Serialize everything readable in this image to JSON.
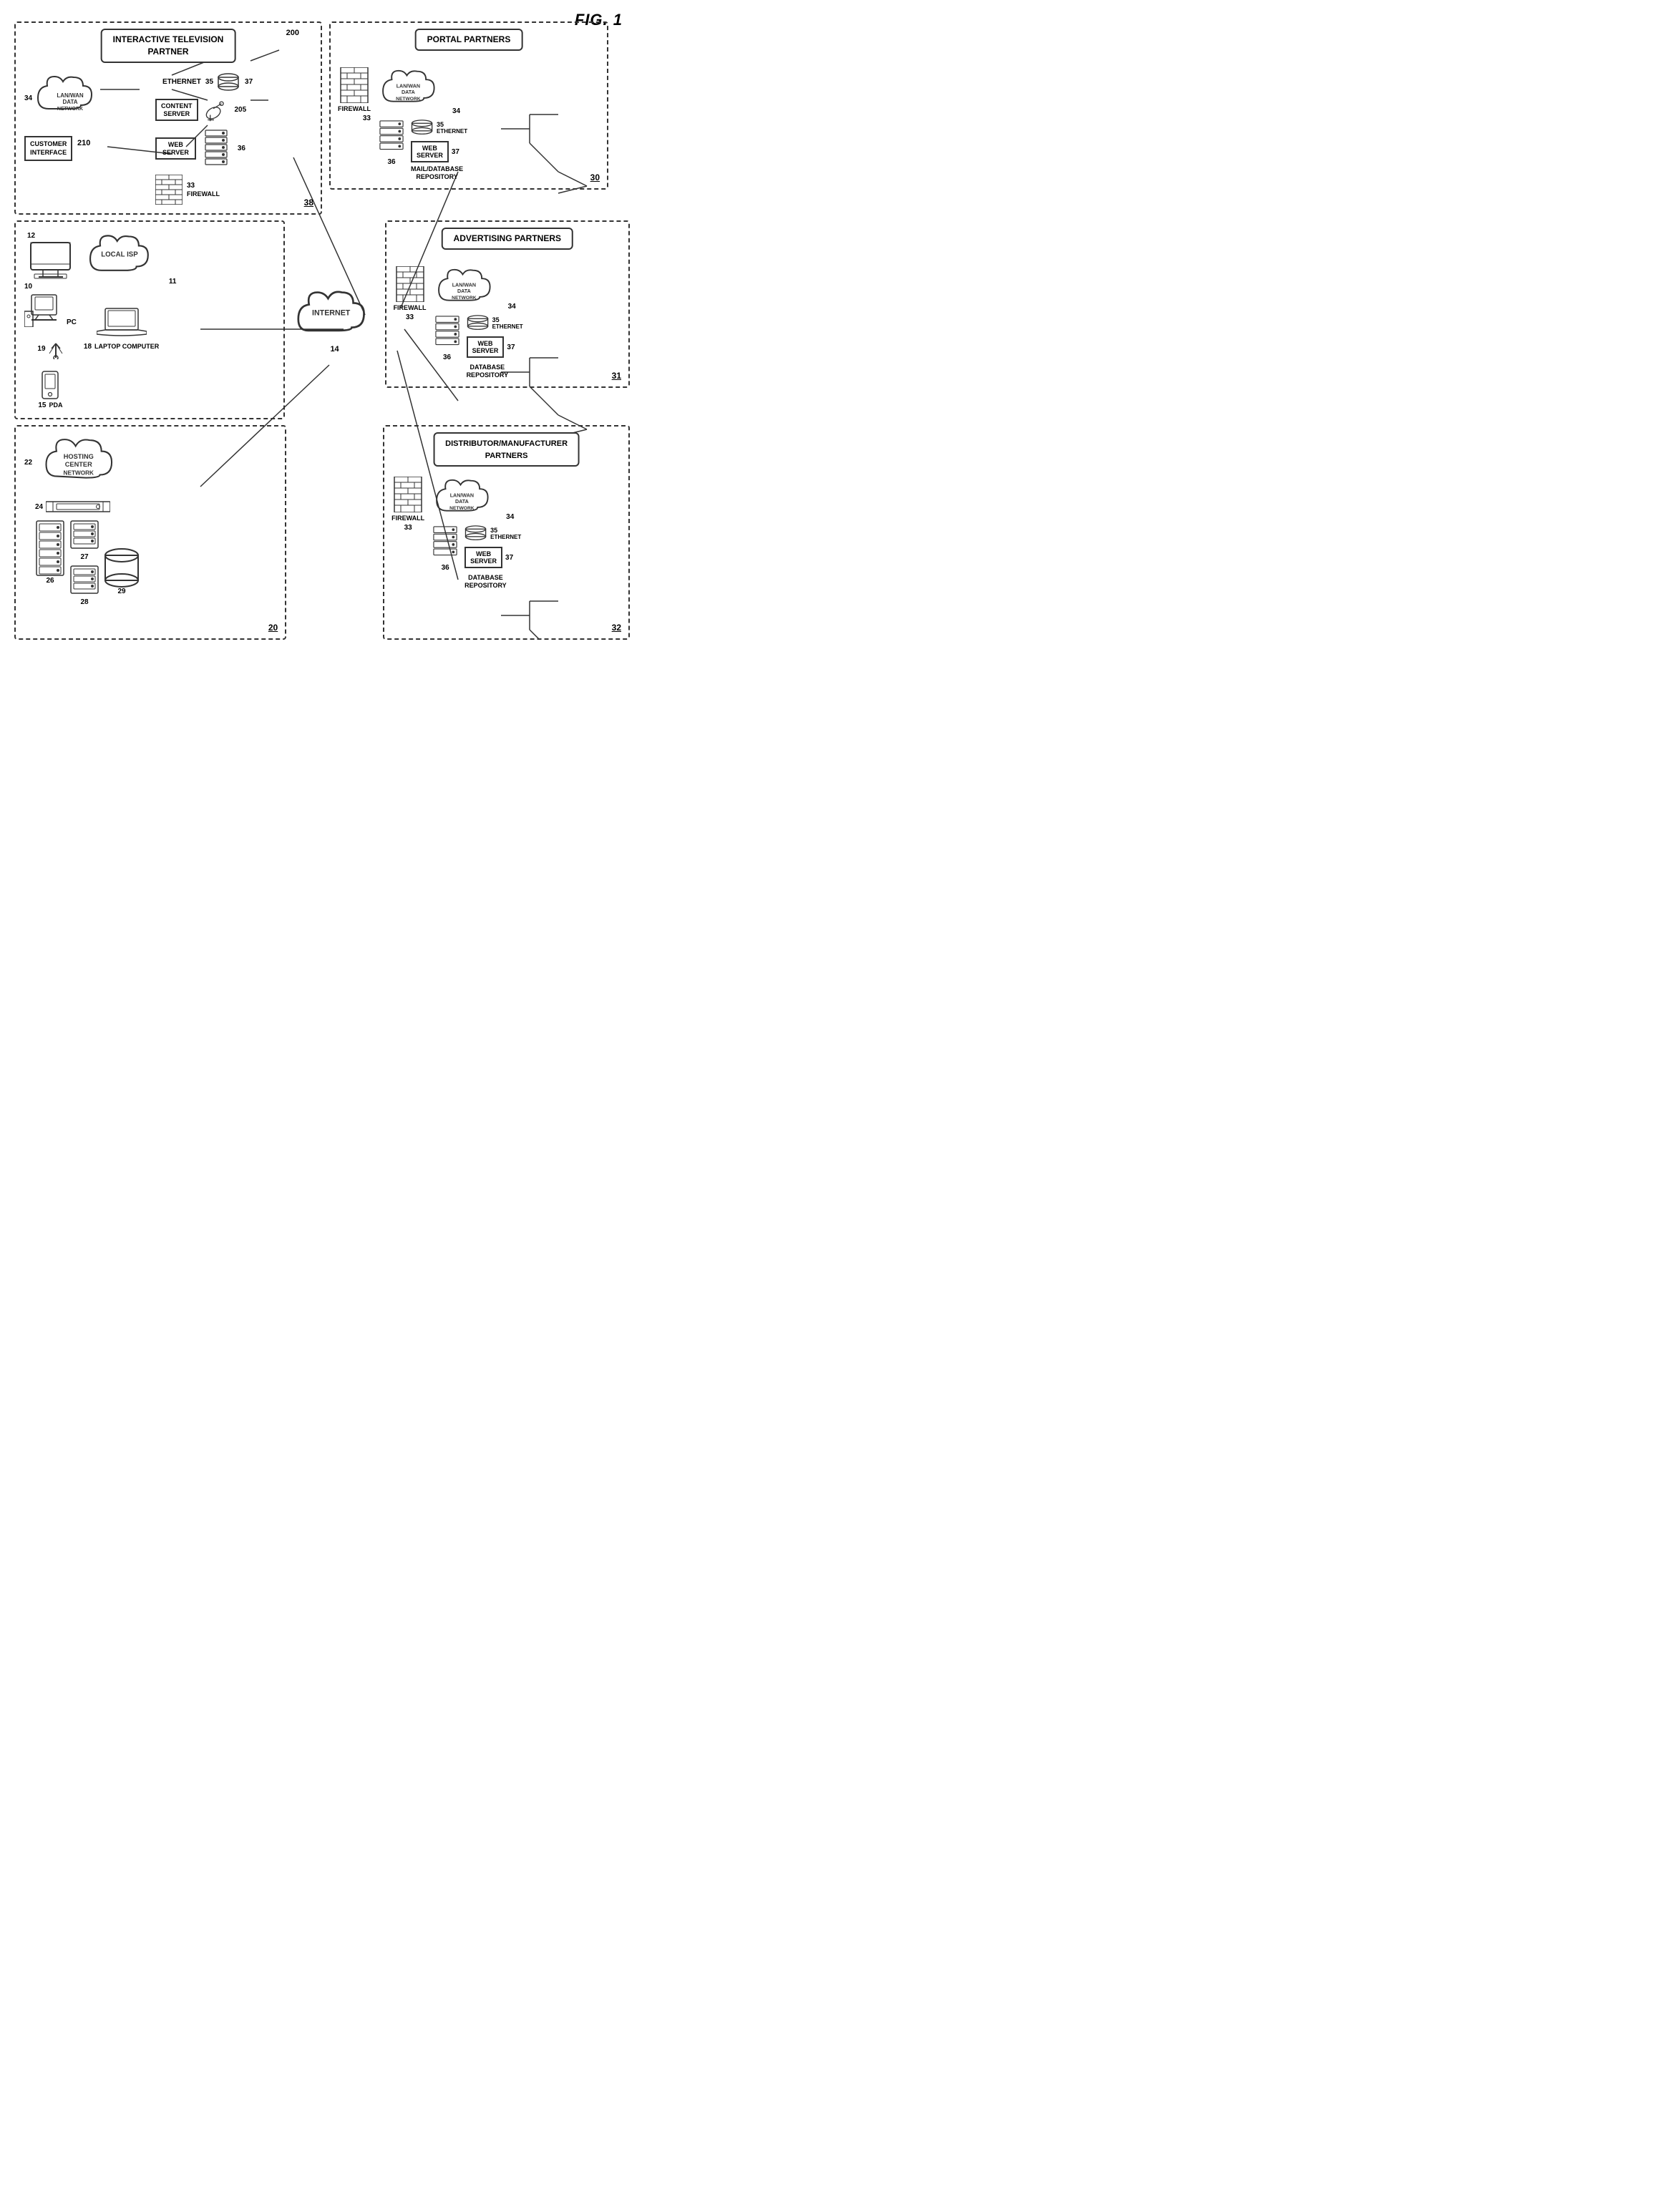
{
  "fig_title": "FIG. 1",
  "itp": {
    "title": "INTERACTIVE TELEVISION\nPARTNER",
    "ref": "200",
    "content_server_label": "CONTENT\nSERVER",
    "content_server_ref": "205",
    "web_server_label": "WEB\nSERVER",
    "ethernet_label": "ETHERNET",
    "ethernet_ref": "35",
    "lan_wan_label": "LAN/WAN\nDATA\nNETWORK",
    "lan_wan_ref": "34",
    "customer_interface_label": "CUSTOMER\nINTERFACE",
    "customer_interface_ref": "210",
    "firewall_label": "FIREWALL",
    "firewall_ref": "33",
    "web_server_ref": "36",
    "itp_ref": "38",
    "router_ref": "37"
  },
  "local_isp": {
    "pc_label": "PC",
    "pc_ref": "10",
    "antenna_ref": "19",
    "monitor_label": "",
    "monitor_ref": "12",
    "pda_label": "PDA",
    "pda_ref": "15",
    "laptop_label": "LAPTOP COMPUTER",
    "laptop_ref": "18",
    "local_isp_label": "LOCAL ISP",
    "local_isp_ref": "11"
  },
  "hosting": {
    "title": "HOSTING\nCENTER NETWORK",
    "ref": "22",
    "rack_ref": "24",
    "server1_ref": "26",
    "server2_ref": "27",
    "server3_ref": "28",
    "database_ref": "29",
    "main_ref": "20"
  },
  "internet": {
    "label": "INTERNET",
    "ref": "14"
  },
  "portal_partners": {
    "title": "PORTAL PARTNERS",
    "ref": "30",
    "firewall_label": "FIREWALL",
    "firewall_ref": "33",
    "lan_wan_label": "LAN/WAN\nDATA\nNETWORK",
    "lan_wan_ref": "34",
    "ethernet_label": "ETHERNET",
    "ethernet_ref": "35",
    "server_ref": "36",
    "web_server_label": "WEB\nSERVER",
    "web_server_ref": "37",
    "mail_db_label": "MAIL/DATABASE\nREPOSITORY"
  },
  "advertising_partners": {
    "title": "ADVERTISING PARTNERS",
    "ref": "31",
    "firewall_label": "FIREWALL",
    "firewall_ref": "33",
    "lan_wan_label": "LAN/WAN\nDATA\nNETWORK",
    "lan_wan_ref": "34",
    "ethernet_label": "ETHERNET",
    "ethernet_ref": "35",
    "server_ref": "36",
    "web_server_label": "WEB\nSERVER",
    "web_server_ref": "37",
    "db_label": "DATABASE\nREPOSITORY"
  },
  "distributor_partners": {
    "title": "DISTRIBUTOR/MANUFACTURER\nPARTNERS",
    "ref": "32",
    "firewall_label": "FIREWALL",
    "firewall_ref": "33",
    "lan_wan_label": "LAN/WAN\nDATA\nNETWORK",
    "lan_wan_ref": "34",
    "ethernet_label": "ETHERNET",
    "ethernet_ref": "35",
    "server_ref": "36",
    "web_server_label": "WEB\nSERVER",
    "web_server_ref": "37",
    "db_label": "DATABASE\nREPOSITORY"
  }
}
